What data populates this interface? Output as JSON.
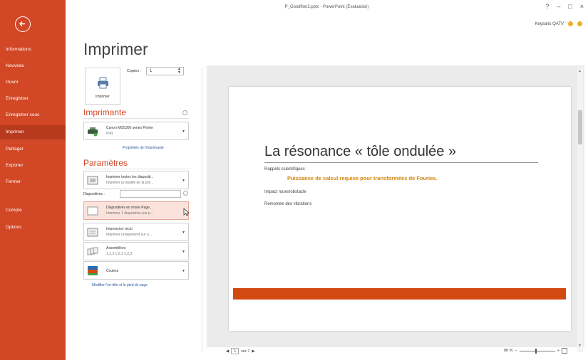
{
  "colors": {
    "accent": "#d24726",
    "link": "#2b579a",
    "highlight_text": "#d4860b",
    "slide_bar": "#d24a12"
  },
  "titlebar": {
    "doc_title": "P_Goodflon2.pptx - PowerPoint (Évaluation)",
    "controls": [
      "?",
      "–",
      "□",
      "×"
    ],
    "user_name": "Keysaris QATV"
  },
  "nav": {
    "back_icon": "back-arrow-icon",
    "items": [
      {
        "label": "Informations"
      },
      {
        "label": "Nouveau"
      },
      {
        "label": "Ouvrir"
      },
      {
        "label": "Enregistrer"
      },
      {
        "label": "Enregistrer sous"
      },
      {
        "label": "Imprimer",
        "selected": true
      },
      {
        "label": "Partager"
      },
      {
        "label": "Exporter"
      },
      {
        "label": "Fermer"
      },
      {
        "label": "Compte"
      },
      {
        "label": "Options"
      }
    ]
  },
  "print": {
    "title": "Imprimer",
    "print_button_label": "Imprimer",
    "copies_label": "Copies :",
    "copies_value": "1",
    "printer_heading": "Imprimante",
    "printer_name": "Canon MG5300 series Printer",
    "printer_status": "Prêt",
    "printer_properties_link": "Propriétés de l'imprimante",
    "settings_heading": "Paramètres",
    "settings": [
      {
        "line1": "Imprimer toutes les diapositi...",
        "line2": "Imprimer la totalité de la pré..."
      },
      {
        "line1": "Diapositives en mode Page...",
        "line2": "Imprimer 1 diapositive par p..."
      },
      {
        "line1": "Impression recto",
        "line2": "Imprimer uniquement sur u..."
      },
      {
        "line1": "Assemblées",
        "line2": "1,2,3   1,2,3   1,2,3"
      },
      {
        "line1": "Couleur",
        "line2": ""
      }
    ],
    "slides_label": "Diapositives :",
    "slides_value": "",
    "header_footer_link": "Modifier l'en-tête et le pied de page"
  },
  "preview": {
    "slide_title": "La résonance « tôle ondulée »",
    "bullets": [
      {
        "text": "Rappels scientifiques"
      },
      {
        "text": "Puissance de calcul requise pour transformées de Fouries."
      },
      {
        "text": "Impact roues/obstacle"
      },
      {
        "text": "Remontée des vibrations"
      }
    ],
    "page_current": "1",
    "page_total": "sur 7",
    "zoom": "88 %"
  }
}
